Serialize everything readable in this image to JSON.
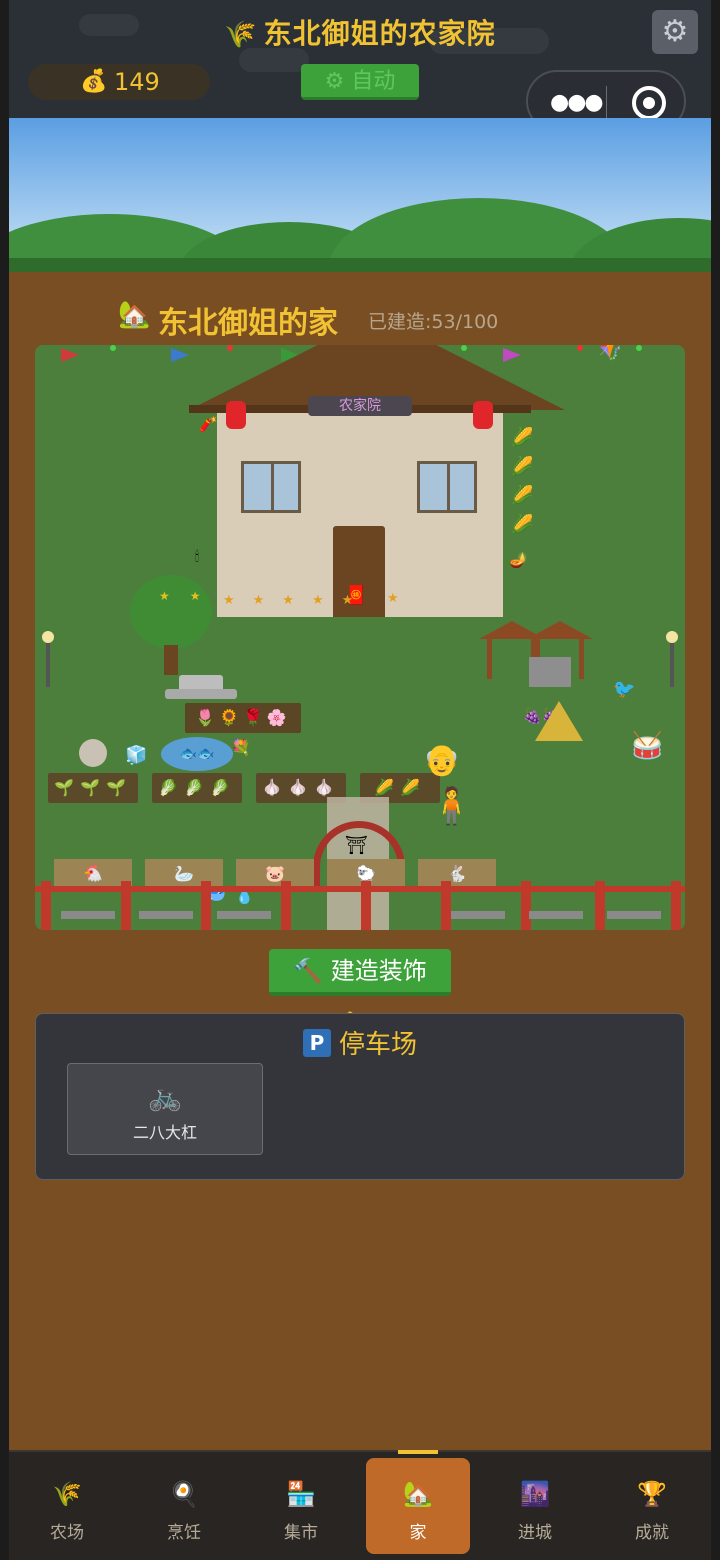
{
  "header": {
    "title_icon": "wheat-icon",
    "title": "东北御姐的农家院",
    "settings_icon": "gear-icon",
    "coins": "149",
    "coin_icon": "money-bag-icon",
    "auto_label": "⚙ 自动"
  },
  "house": {
    "icon": "house-icon",
    "name": "东北御姐的家",
    "built_count": "已建造:53/100",
    "sign": "农家院"
  },
  "build_button": {
    "icon": "hammer-icon",
    "label": "建造装饰"
  },
  "parking": {
    "badge": "P",
    "title": "停车场",
    "slots": [
      {
        "icon": "bicycle-icon",
        "label": "二八大杠"
      }
    ]
  },
  "nav": {
    "active_index": 3,
    "items": [
      {
        "icon": "wheat-icon",
        "label": "农场"
      },
      {
        "icon": "cooking-icon",
        "label": "烹饪"
      },
      {
        "icon": "market-icon",
        "label": "集市"
      },
      {
        "icon": "house-icon",
        "label": "家"
      },
      {
        "icon": "city-icon",
        "label": "进城"
      },
      {
        "icon": "trophy-icon",
        "label": "成就"
      }
    ]
  },
  "colors": {
    "accent": "#f1c232",
    "green_button": "#3ea23a",
    "active_tab": "#c06a2a",
    "ground": "#7a4e23"
  }
}
